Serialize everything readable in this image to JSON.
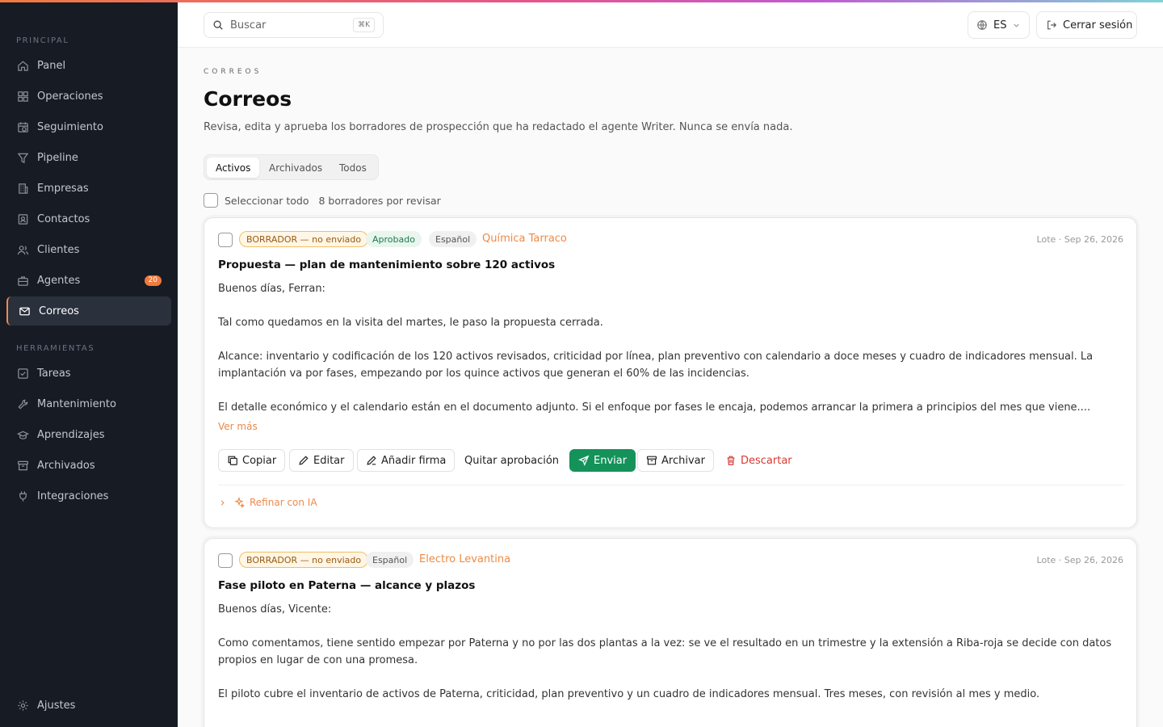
{
  "sidebar": {
    "sections": [
      {
        "label": "PRINCIPAL"
      },
      {
        "label": "HERRAMIENTAS"
      }
    ],
    "items": [
      {
        "label": "Panel",
        "icon": "home-icon"
      },
      {
        "label": "Operaciones",
        "icon": "grid-icon"
      },
      {
        "label": "Seguimiento",
        "icon": "calendar-clock-icon"
      },
      {
        "label": "Pipeline",
        "icon": "filter-icon"
      },
      {
        "label": "Empresas",
        "icon": "building-icon"
      },
      {
        "label": "Contactos",
        "icon": "contact-card-icon"
      },
      {
        "label": "Clientes",
        "icon": "users-icon"
      },
      {
        "label": "Agentes",
        "icon": "briefcase-icon",
        "badge": "20"
      },
      {
        "label": "Correos",
        "icon": "mail-icon",
        "active": true
      },
      {
        "label": "Tareas",
        "icon": "checkbox-icon"
      },
      {
        "label": "Mantenimiento",
        "icon": "wrench-icon"
      },
      {
        "label": "Aprendizajes",
        "icon": "graduation-cap-icon"
      },
      {
        "label": "Archivados",
        "icon": "archive-icon"
      },
      {
        "label": "Integraciones",
        "icon": "plug-icon"
      }
    ],
    "settings": {
      "label": "Ajustes",
      "icon": "gear-icon"
    }
  },
  "header": {
    "search_placeholder": "Buscar",
    "search_shortcut": "⌘K",
    "language": "ES",
    "logout": "Cerrar sesión"
  },
  "page": {
    "eyebrow": "CORREOS",
    "title": "Correos",
    "subtitle": "Revisa, edita y aprueba los borradores de prospección que ha redactado el agente Writer. Nunca se envía nada."
  },
  "tabs": [
    "Activos",
    "Archivados",
    "Todos"
  ],
  "active_tab": "Activos",
  "select_all": "Seleccionar todo",
  "pending_count": "8 borradores por revisar",
  "accent_color": "#f07b3f",
  "cards": [
    {
      "status": "BORRADOR — no enviado",
      "approved": "Aprobado",
      "language": "Español",
      "company": "Química Tarraco",
      "meta": "Lote · Sep 26, 2026",
      "subject": "Propuesta — plan de mantenimiento sobre 120 activos",
      "greeting": "Buenos días, Ferran:",
      "paragraphs": [
        "Tal como quedamos en la visita del martes, le paso la propuesta cerrada.",
        "Alcance: inventario y codificación de los 120 activos revisados, criticidad por línea, plan preventivo con calendario a doce meses y cuadro de indicadores mensual. La implantación va por fases, empezando por los quince activos que generan el 60% de las incidencias.",
        "El detalle económico y el calendario están en el documento adjunto. Si el enfoque por fases le encaja, podemos arrancar la primera a principios del mes que viene...."
      ],
      "more": "Ver más",
      "actions": {
        "copy": "Copiar",
        "edit": "Editar",
        "signature": "Añadir firma",
        "unapprove": "Quitar aprobación",
        "send": "Enviar",
        "archive": "Archivar",
        "discard": "Descartar"
      },
      "refine": "Refinar con IA"
    },
    {
      "status": "BORRADOR — no enviado",
      "language": "Español",
      "company": "Electro Levantina",
      "meta": "Lote · Sep 26, 2026",
      "subject": "Fase piloto en Paterna — alcance y plazos",
      "greeting": "Buenos días, Vicente:",
      "paragraphs": [
        "Como comentamos, tiene sentido empezar por Paterna y no por las dos plantas a la vez: se ve el resultado en un trimestre y la extensión a Riba-roja se decide con datos propios en lugar de con una promesa.",
        "El piloto cubre el inventario de activos de Paterna, criticidad, plan preventivo y un cuadro de indicadores mensual. Tres meses, con revisión al mes y medio."
      ]
    }
  ]
}
